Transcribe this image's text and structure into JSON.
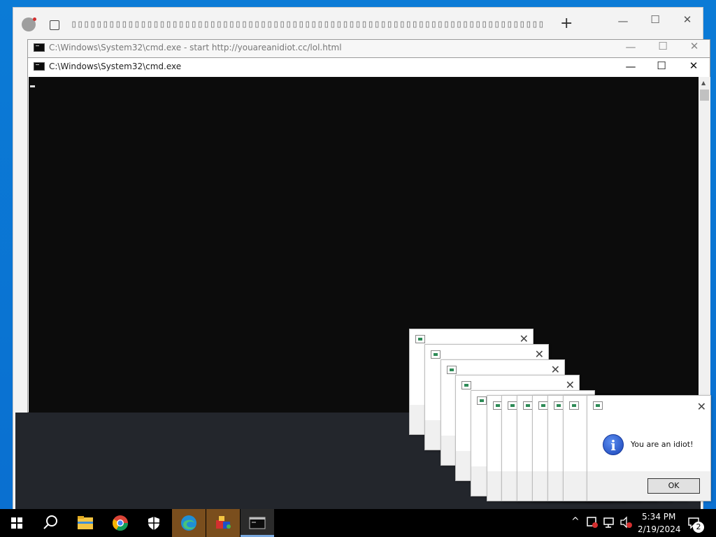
{
  "browser": {
    "new_tab_symbol": "+",
    "tab_glyphs": "▯▯▯▯▯▯▯▯▯▯▯▯▯▯▯▯▯▯▯▯▯▯▯▯▯▯▯▯▯▯▯▯▯▯▯▯▯▯▯▯▯▯▯▯▯▯▯▯▯▯▯▯▯▯▯▯▯▯▯▯▯▯▯▯▯▯▯▯▯▯▯▯▯▯▯▯▯▯▯▯▯"
  },
  "cmd_back": {
    "title": "C:\\Windows\\System32\\cmd.exe - start  http://youareanidiot.cc/lol.html"
  },
  "cmd_front": {
    "title": "C:\\Windows\\System32\\cmd.exe"
  },
  "caption": {
    "minimize": "—",
    "maximize": "☐",
    "close": "✕"
  },
  "dialog": {
    "message": "You are an idiot!",
    "ok_label": "OK",
    "icon": "info-icon",
    "icon_glyph": "i"
  },
  "taskbar": {
    "time": "5:34 PM",
    "date": "2/19/2024",
    "notification_count": "2",
    "tray_chevron": "^",
    "apps": [
      {
        "name": "windows-start-icon"
      },
      {
        "name": "search-icon"
      },
      {
        "name": "file-explorer-icon"
      },
      {
        "name": "chrome-icon"
      },
      {
        "name": "windows-security-icon"
      },
      {
        "name": "edge-icon"
      },
      {
        "name": "app-cube-icon"
      },
      {
        "name": "cmd-icon"
      }
    ]
  },
  "colors": {
    "desktop": "#0a6fd0",
    "console": "#0c0c0c",
    "taskbar": "#000000",
    "active_app": "#7a4e1d"
  }
}
